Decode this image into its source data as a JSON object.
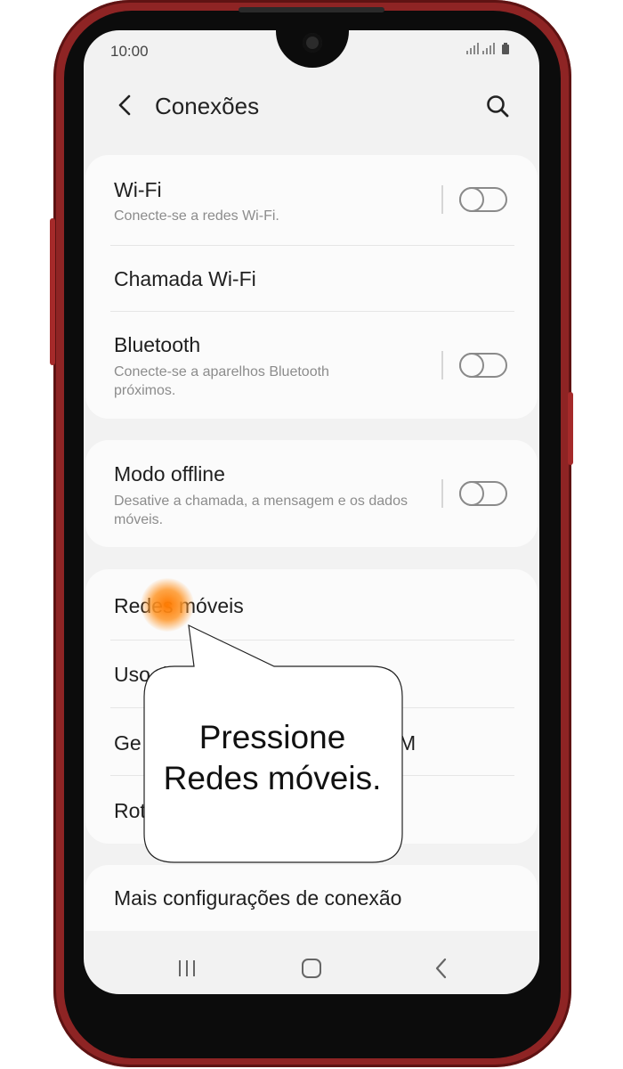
{
  "status_bar": {
    "time": "10:00",
    "signal_icons": "signal-icons"
  },
  "header": {
    "title": "Conexões"
  },
  "sections": {
    "card1": {
      "wifi": {
        "title": "Wi-Fi",
        "desc": "Conecte-se a redes Wi-Fi.",
        "toggle": "off"
      },
      "wifi_calling": {
        "title": "Chamada Wi-Fi"
      },
      "bluetooth": {
        "title": "Bluetooth",
        "desc": "Conecte-se a aparelhos Bluetooth próximos.",
        "toggle": "off"
      }
    },
    "card2": {
      "offline": {
        "title": "Modo offline",
        "desc": "Desative a chamada, a mensagem e os dados móveis.",
        "toggle": "off"
      }
    },
    "card3": {
      "mobile_networks": {
        "title": "Redes móveis"
      },
      "data_usage": {
        "title": "Uso d"
      },
      "sim_manager": {
        "title": "Ge",
        "tail": "M"
      },
      "router": {
        "title": "Rot"
      }
    },
    "card4": {
      "more": {
        "title": "Mais configurações de conexão"
      }
    }
  },
  "callout": {
    "text": "Pressione\nRedes móveis."
  },
  "navbar": {
    "recent": "recent-apps-icon",
    "home": "home-icon",
    "back": "back-icon"
  },
  "colors": {
    "phone_body": "#8e2424",
    "accent_tap": "#ff7a00",
    "screen_bg": "#f2f2f2"
  }
}
